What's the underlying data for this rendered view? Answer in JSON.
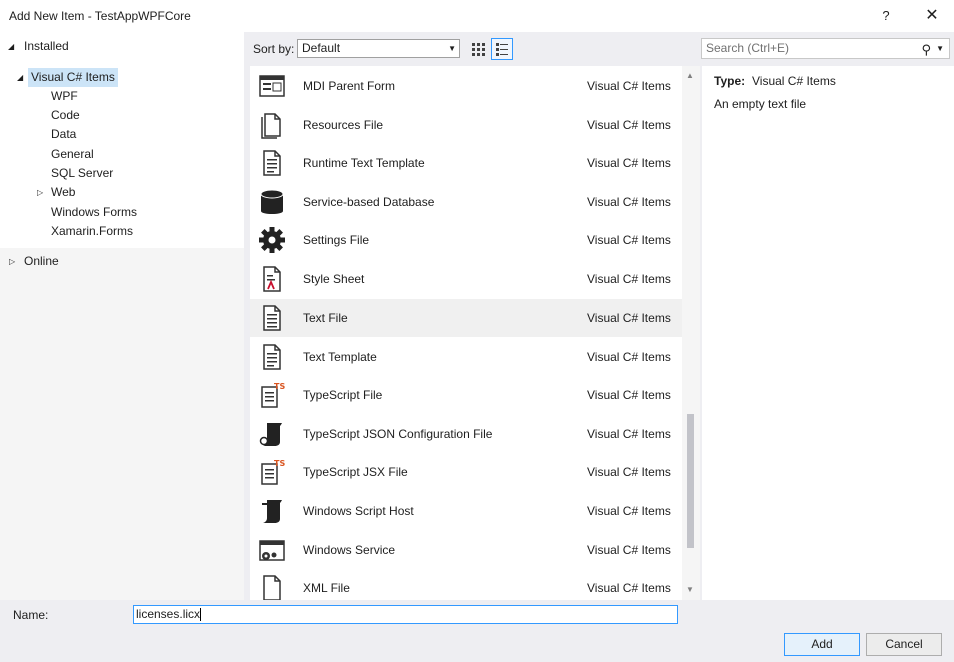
{
  "window": {
    "title": "Add New Item - TestAppWPFCore",
    "help_label": "?",
    "close_label": "✕"
  },
  "tree": {
    "installed_label": "Installed",
    "root_label": "Visual C# Items",
    "children": [
      "WPF",
      "Code",
      "Data",
      "General",
      "SQL Server",
      "Web",
      "Windows Forms",
      "Xamarin.Forms"
    ],
    "online_label": "Online"
  },
  "toolbar": {
    "sort_label": "Sort by:",
    "sort_value": "Default",
    "search_placeholder": "Search (Ctrl+E)"
  },
  "items": [
    {
      "name": "MDI Parent Form",
      "category": "Visual C# Items",
      "icon": "mdi-form-icon"
    },
    {
      "name": "Resources File",
      "category": "Visual C# Items",
      "icon": "resources-file-icon"
    },
    {
      "name": "Runtime Text Template",
      "category": "Visual C# Items",
      "icon": "text-template-icon"
    },
    {
      "name": "Service-based Database",
      "category": "Visual C# Items",
      "icon": "database-icon"
    },
    {
      "name": "Settings File",
      "category": "Visual C# Items",
      "icon": "gear-icon"
    },
    {
      "name": "Style Sheet",
      "category": "Visual C# Items",
      "icon": "style-sheet-icon"
    },
    {
      "name": "Text File",
      "category": "Visual C# Items",
      "icon": "text-file-icon",
      "selected": true
    },
    {
      "name": "Text Template",
      "category": "Visual C# Items",
      "icon": "text-template-icon"
    },
    {
      "name": "TypeScript File",
      "category": "Visual C# Items",
      "icon": "typescript-file-icon"
    },
    {
      "name": "TypeScript JSON Configuration File",
      "category": "Visual C# Items",
      "icon": "script-icon"
    },
    {
      "name": "TypeScript JSX File",
      "category": "Visual C# Items",
      "icon": "typescript-file-icon"
    },
    {
      "name": "Windows Script Host",
      "category": "Visual C# Items",
      "icon": "script-icon"
    },
    {
      "name": "Windows Service",
      "category": "Visual C# Items",
      "icon": "windows-service-icon"
    },
    {
      "name": "XML File",
      "category": "Visual C# Items",
      "icon": "xml-file-icon"
    }
  ],
  "details": {
    "type_label": "Type:",
    "type_value": "Visual C# Items",
    "description": "An empty text file"
  },
  "bottom": {
    "name_label": "Name:",
    "name_value": "licenses.licx",
    "add_label": "Add",
    "cancel_label": "Cancel"
  },
  "colors": {
    "accent": "#3399ff",
    "selection": "#cce4f7",
    "ts_badge": "#d9531e"
  }
}
